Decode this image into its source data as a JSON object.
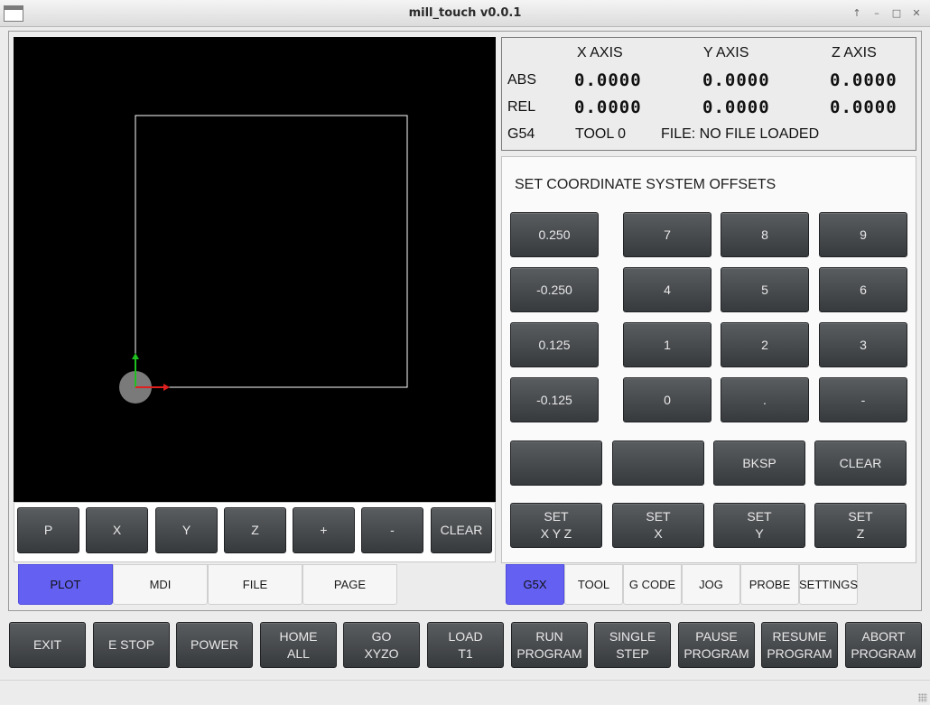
{
  "window": {
    "title": "mill_touch v0.0.1",
    "controls": [
      "↑",
      "–",
      "□",
      "✕"
    ]
  },
  "plot": {
    "buttons": [
      "P",
      "X",
      "Y",
      "Z",
      "+",
      "-",
      "CLEAR"
    ]
  },
  "dro": {
    "headers": [
      "X AXIS",
      "Y AXIS",
      "Z AXIS"
    ],
    "rows": [
      {
        "label": "ABS",
        "values": [
          "0.0000",
          "0.0000",
          "0.0000"
        ]
      },
      {
        "label": "REL",
        "values": [
          "0.0000",
          "0.0000",
          "0.0000"
        ]
      }
    ],
    "status": {
      "coord": "G54",
      "tool": "TOOL 0",
      "file": "FILE: NO FILE LOADED"
    }
  },
  "offsets": {
    "title": "SET COORDINATE SYSTEM OFFSETS",
    "increments": [
      "0.250",
      "-0.250",
      "0.125",
      "-0.125"
    ],
    "keypad": [
      "7",
      "8",
      "9",
      "4",
      "5",
      "6",
      "1",
      "2",
      "3",
      "0",
      ".",
      "-"
    ],
    "entry_row": [
      "",
      "",
      "BKSP",
      "CLEAR"
    ],
    "set_row": [
      [
        "SET",
        "X Y Z"
      ],
      [
        "SET",
        "X"
      ],
      [
        "SET",
        "Y"
      ],
      [
        "SET",
        "Z"
      ]
    ]
  },
  "left_tabs": [
    "PLOT",
    "MDI",
    "FILE",
    "PAGE"
  ],
  "right_tabs": [
    "G5X",
    "TOOL",
    "G CODE",
    "JOG",
    "PROBE",
    "SETTINGS"
  ],
  "bottom_buttons": [
    [
      "EXIT"
    ],
    [
      "E STOP"
    ],
    [
      "POWER"
    ],
    [
      "HOME",
      "ALL"
    ],
    [
      "GO",
      "XYZO"
    ],
    [
      "LOAD",
      "T1"
    ],
    [
      "RUN",
      "PROGRAM"
    ],
    [
      "SINGLE",
      "STEP"
    ],
    [
      "PAUSE",
      "PROGRAM"
    ],
    [
      "RESUME",
      "PROGRAM"
    ],
    [
      "ABORT",
      "PROGRAM"
    ]
  ],
  "colors": {
    "active_tab": "#6360f2",
    "axis_x": "#e02020",
    "axis_y": "#20c020"
  }
}
